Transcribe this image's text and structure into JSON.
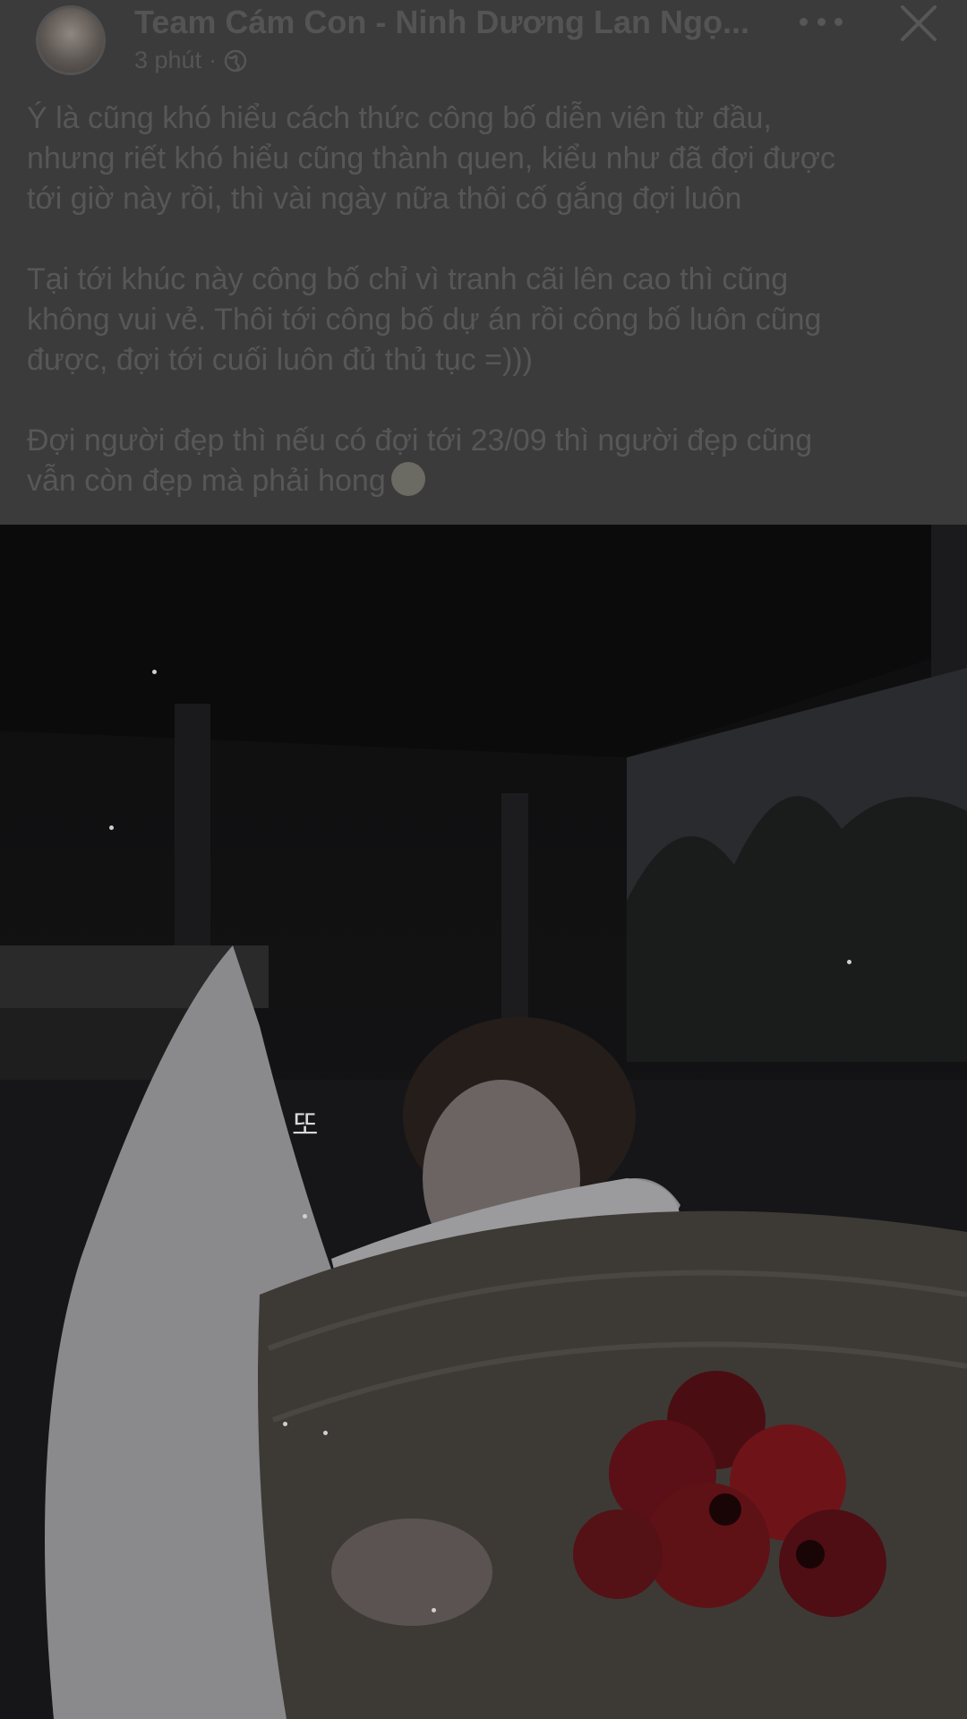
{
  "header": {
    "author_name": "Team Cám Con - Ninh Dương Lan Ngọ...",
    "time": "3 phút",
    "separator": "·",
    "avatar": "page-avatar",
    "privacy_icon": "globe-icon",
    "more_icon": "more-options-icon",
    "close_icon": "close-icon"
  },
  "post": {
    "paragraphs": [
      "Ý là cũng khó hiểu cách thức công bố diễn viên từ đầu,\nnhưng riết khó hiểu cũng thành quen, kiểu như đã đợi được\ntới giờ này rồi, thì vài ngày nữa thôi cố gắng đợi luôn",
      "Tại tới khúc này công bố chỉ vì tranh cãi lên cao thì cũng\nkhông vui vẻ. Thôi tới công bố dự án rồi công bố luôn cũng\nđược, đợi tới cuối luôn đủ thủ tục =)))",
      "Đợi người đẹp thì nếu có đợi tới 23/09 thì người đẹp cũng\nvẫn còn đẹp mà phải hong"
    ],
    "emoji": "laughing-tears-emoji"
  },
  "photo": {
    "caption": "또"
  },
  "colors": {
    "overlay_bg": "#3b3b3c",
    "text_dimmed": "#575757",
    "photo_bg": "#121213",
    "flower_red": "#6e1418"
  }
}
